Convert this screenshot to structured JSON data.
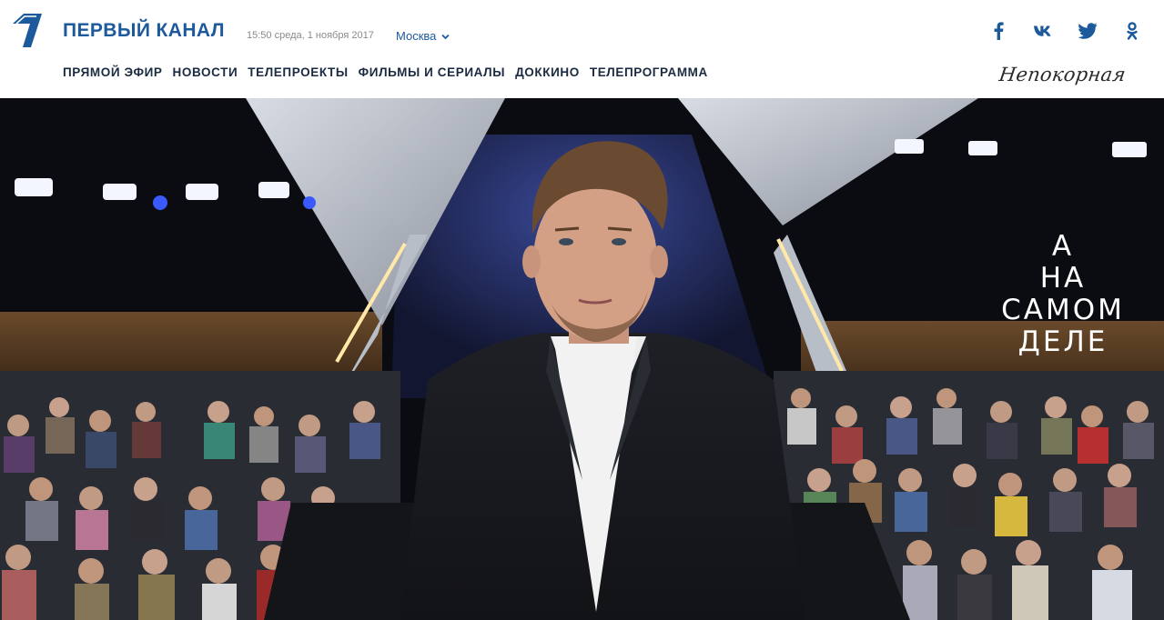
{
  "header": {
    "brand": "ПЕРВЫЙ КАНАЛ",
    "datetime": "15:50 среда, 1 ноября 2017",
    "city": "Москва",
    "nav": [
      {
        "label": "ПРЯМОЙ ЭФИР"
      },
      {
        "label": "НОВОСТИ"
      },
      {
        "label": "ТЕЛЕПРОЕКТЫ"
      },
      {
        "label": "ФИЛЬМЫ И СЕРИАЛЫ"
      },
      {
        "label": "ДОККИНО"
      },
      {
        "label": "ТЕЛЕПРОГРАММА"
      }
    ],
    "social": [
      "facebook-icon",
      "vk-icon",
      "twitter-icon",
      "odnoklassniki-icon"
    ],
    "promo": "Непокорная"
  },
  "hero": {
    "show_title_lines": [
      "А",
      "НА",
      "САМОМ",
      "ДЕЛЕ"
    ]
  },
  "colors": {
    "brand_blue": "#1c5a9c",
    "nav_text": "#1a2a40"
  }
}
